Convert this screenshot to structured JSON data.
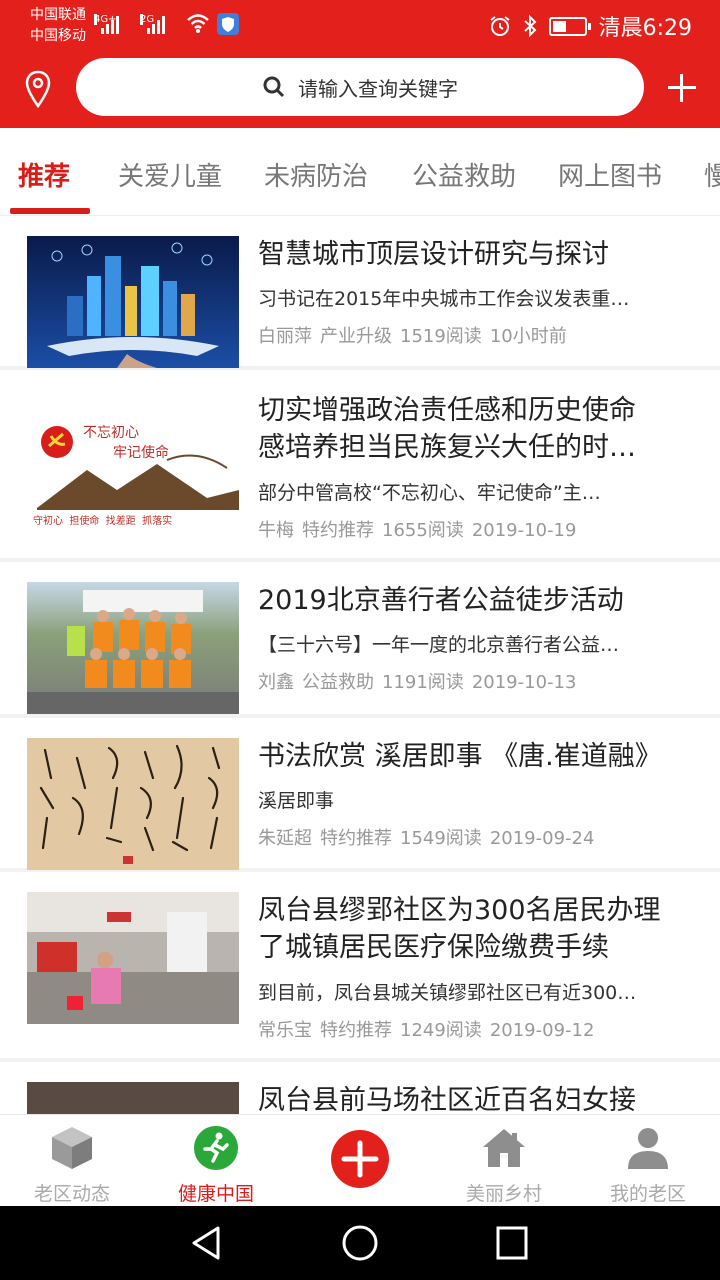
{
  "status": {
    "carrier1": "中国联通",
    "carrier2": "中国移动",
    "net1": "4G+",
    "net2": "2G",
    "time": "清晨6:29",
    "battery_level": 0.45
  },
  "search": {
    "placeholder": "请输入查询关键字"
  },
  "tabs": [
    {
      "label": "推荐",
      "active": true
    },
    {
      "label": "关爱儿童"
    },
    {
      "label": "未病防治"
    },
    {
      "label": "公益救助"
    },
    {
      "label": "网上图书"
    },
    {
      "label": "慢"
    }
  ],
  "feed": [
    {
      "title_lines": [
        "智慧城市顶层设计研究与探讨"
      ],
      "summary": "习书记在2015年中央城市工作会议发表重…",
      "author": "白丽萍",
      "category": "产业升级",
      "reads": "1519阅读",
      "date": "10小时前"
    },
    {
      "title_lines": [
        "切实增强政治责任感和历史使命",
        "感培养担当民族复兴大任的时…"
      ],
      "summary": "部分中管高校“不忘初心、牢记使命”主…",
      "author": "牛梅",
      "category": "特约推荐",
      "reads": "1655阅读",
      "date": "2019-10-19",
      "thumb_text": {
        "slogan1": "不忘初心",
        "slogan2": "牢记使命",
        "bottom": "守初心  担使命  找差距  抓落实"
      }
    },
    {
      "title_lines": [
        "2019北京善行者公益徒步活动"
      ],
      "summary": "【三十六号】一年一度的北京善行者公益…",
      "author": "刘鑫",
      "category": "公益救助",
      "reads": "1191阅读",
      "date": "2019-10-13"
    },
    {
      "title_lines": [
        "书法欣赏 溪居即事 《唐.崔道融》"
      ],
      "summary": "溪居即事",
      "author": "朱延超",
      "category": "特约推荐",
      "reads": "1549阅读",
      "date": "2019-09-24"
    },
    {
      "title_lines": [
        "凤台县缪郢社区为300名居民办理",
        "了城镇居民医疗保险缴费手续"
      ],
      "summary": "到目前，凤台县城关镇缪郢社区已有近300…",
      "author": "常乐宝",
      "category": "特约推荐",
      "reads": "1249阅读",
      "date": "2019-09-12"
    },
    {
      "title_lines": [
        "凤台县前马场社区近百名妇女接"
      ]
    }
  ],
  "tabbar": [
    {
      "label": "老区动态",
      "icon": "cube-icon"
    },
    {
      "label": "健康中国",
      "icon": "runner-icon",
      "active": true
    },
    {
      "label": "",
      "icon": "add-icon"
    },
    {
      "label": "美丽乡村",
      "icon": "house-icon"
    },
    {
      "label": "我的老区",
      "icon": "user-icon"
    }
  ],
  "colors": {
    "accent": "#e4201c",
    "active_tab": "#d81e1a",
    "meta": "#999999"
  }
}
